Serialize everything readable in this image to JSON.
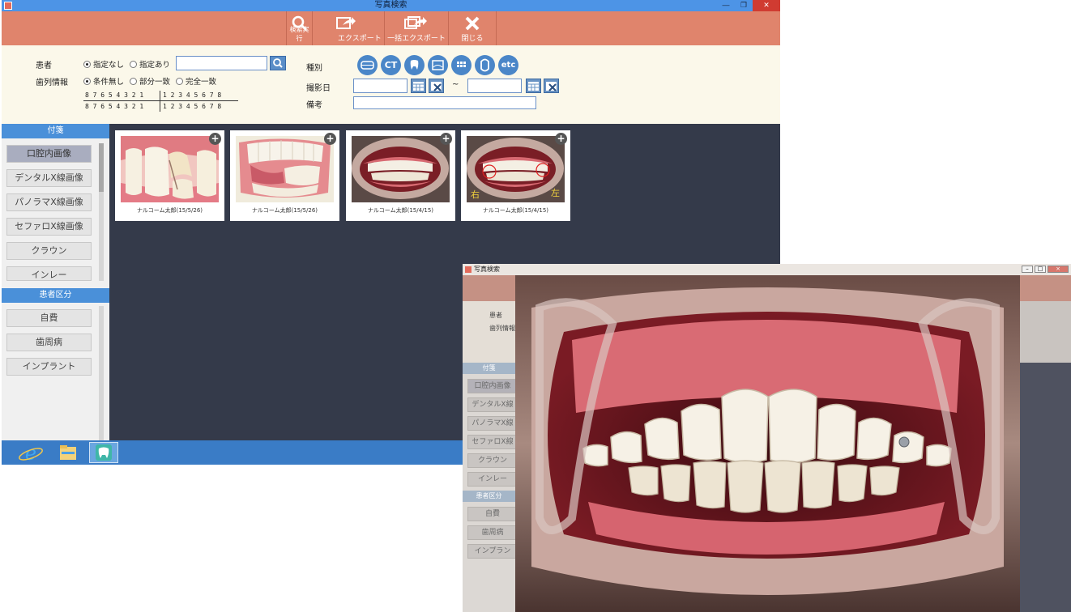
{
  "main_window": {
    "title": "写真検索",
    "toolbar": [
      {
        "label": "検索実行",
        "icon": "search-icon"
      },
      {
        "label": "エクスポート",
        "icon": "export-icon"
      },
      {
        "label": "一括エクスポート",
        "icon": "bulk-export-icon"
      },
      {
        "label": "閉じる",
        "icon": "close-icon"
      }
    ],
    "search": {
      "patient_label": "患者",
      "patient_options": [
        "指定なし",
        "指定あり"
      ],
      "patient_selected": "指定なし",
      "teeth_label": "歯列情報",
      "teeth_options": [
        "条件無し",
        "部分一致",
        "完全一致"
      ],
      "teeth_selected": "条件無し",
      "tooth_chart_left": "8 7 6 5 4 3 2 1",
      "tooth_chart_right": "1 2 3 4 5 6 7 8",
      "type_label": "種別",
      "type_icons": [
        "intraoral-icon",
        "CT",
        "tooth-icon",
        "xray-icon",
        "grid-icon",
        "crown-icon",
        "etc"
      ],
      "date_label": "撮影日",
      "date_separator": "~",
      "note_label": "備考"
    },
    "sidebar": {
      "tags_header": "付箋",
      "tags": [
        "口腔内画像",
        "デンタルX線画像",
        "パノラマX線画像",
        "セファロX線画像",
        "クラウン",
        "インレー"
      ],
      "selected_tag": "口腔内画像",
      "category_header": "患者区分",
      "categories": [
        "自費",
        "歯周病",
        "インプラント"
      ]
    },
    "results": [
      {
        "caption": "ナルコーム太郎(15/5/26)"
      },
      {
        "caption": "ナルコーム太郎(15/5/26)"
      },
      {
        "caption": "ナルコーム太郎(15/4/15)"
      },
      {
        "caption": "ナルコーム太郎(15/4/15)",
        "marks": [
          "右",
          "左"
        ]
      }
    ],
    "taskbar": [
      "ie-icon",
      "file-explorer-icon",
      "dental-app-icon"
    ]
  },
  "viewer_window": {
    "title": "写真検索",
    "ghost_labels": [
      "患者",
      "歯列情報",
      "付箋"
    ],
    "ghost_items": [
      "口腔内画像",
      "デンタルX線",
      "パノラマX線",
      "セファロX線",
      "クラウン",
      "インレー"
    ],
    "ghost_header": "患者区分",
    "ghost_categories": [
      "自費",
      "歯周病",
      "インプラン"
    ]
  },
  "colors": {
    "titlebar": "#4d94e6",
    "toolbar": "#e0846c",
    "panel": "#fbf8ea",
    "results_bg": "#343a4a",
    "sidebar_header": "#4a90d9"
  }
}
